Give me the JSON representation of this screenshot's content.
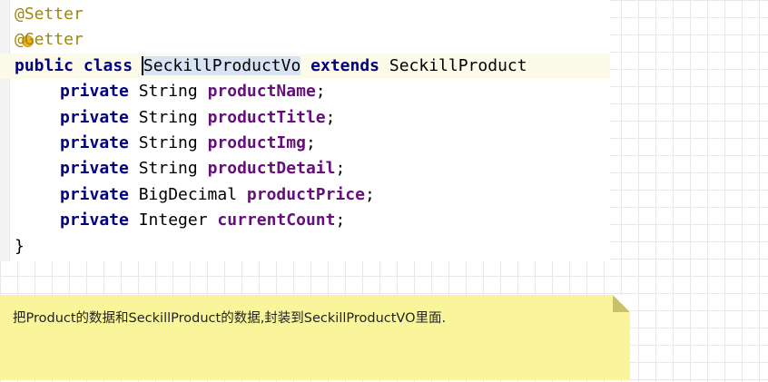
{
  "code": {
    "annotation_setter": "@Setter",
    "annotation_getter": "@Getter",
    "class_decl": {
      "modifier": "public",
      "keyword": "class",
      "class_name_first": "S",
      "class_name_rest": "eckillProductVo",
      "extends_kw": "extends",
      "parent": "SeckillProduct"
    },
    "fields": [
      {
        "modifier": "private",
        "type": "String",
        "name": "productName"
      },
      {
        "modifier": "private",
        "type": "String",
        "name": "productTitle"
      },
      {
        "modifier": "private",
        "type": "String",
        "name": "productImg"
      },
      {
        "modifier": "private",
        "type": "String",
        "name": "productDetail"
      },
      {
        "modifier": "private",
        "type": "BigDecimal",
        "name": "productPrice"
      },
      {
        "modifier": "private",
        "type": "Integer",
        "name": "currentCount"
      }
    ],
    "closing_brace": "}"
  },
  "sticky_note": {
    "text": "把Product的数据和SeckillProduct的数据,封装到SeckillProductVO里面."
  },
  "icons": {
    "intention_bulb": "lightbulb-icon"
  },
  "colors": {
    "annotation": "#9e880d",
    "keyword": "#000080",
    "field": "#660e7a",
    "note_background": "#faf59a"
  }
}
